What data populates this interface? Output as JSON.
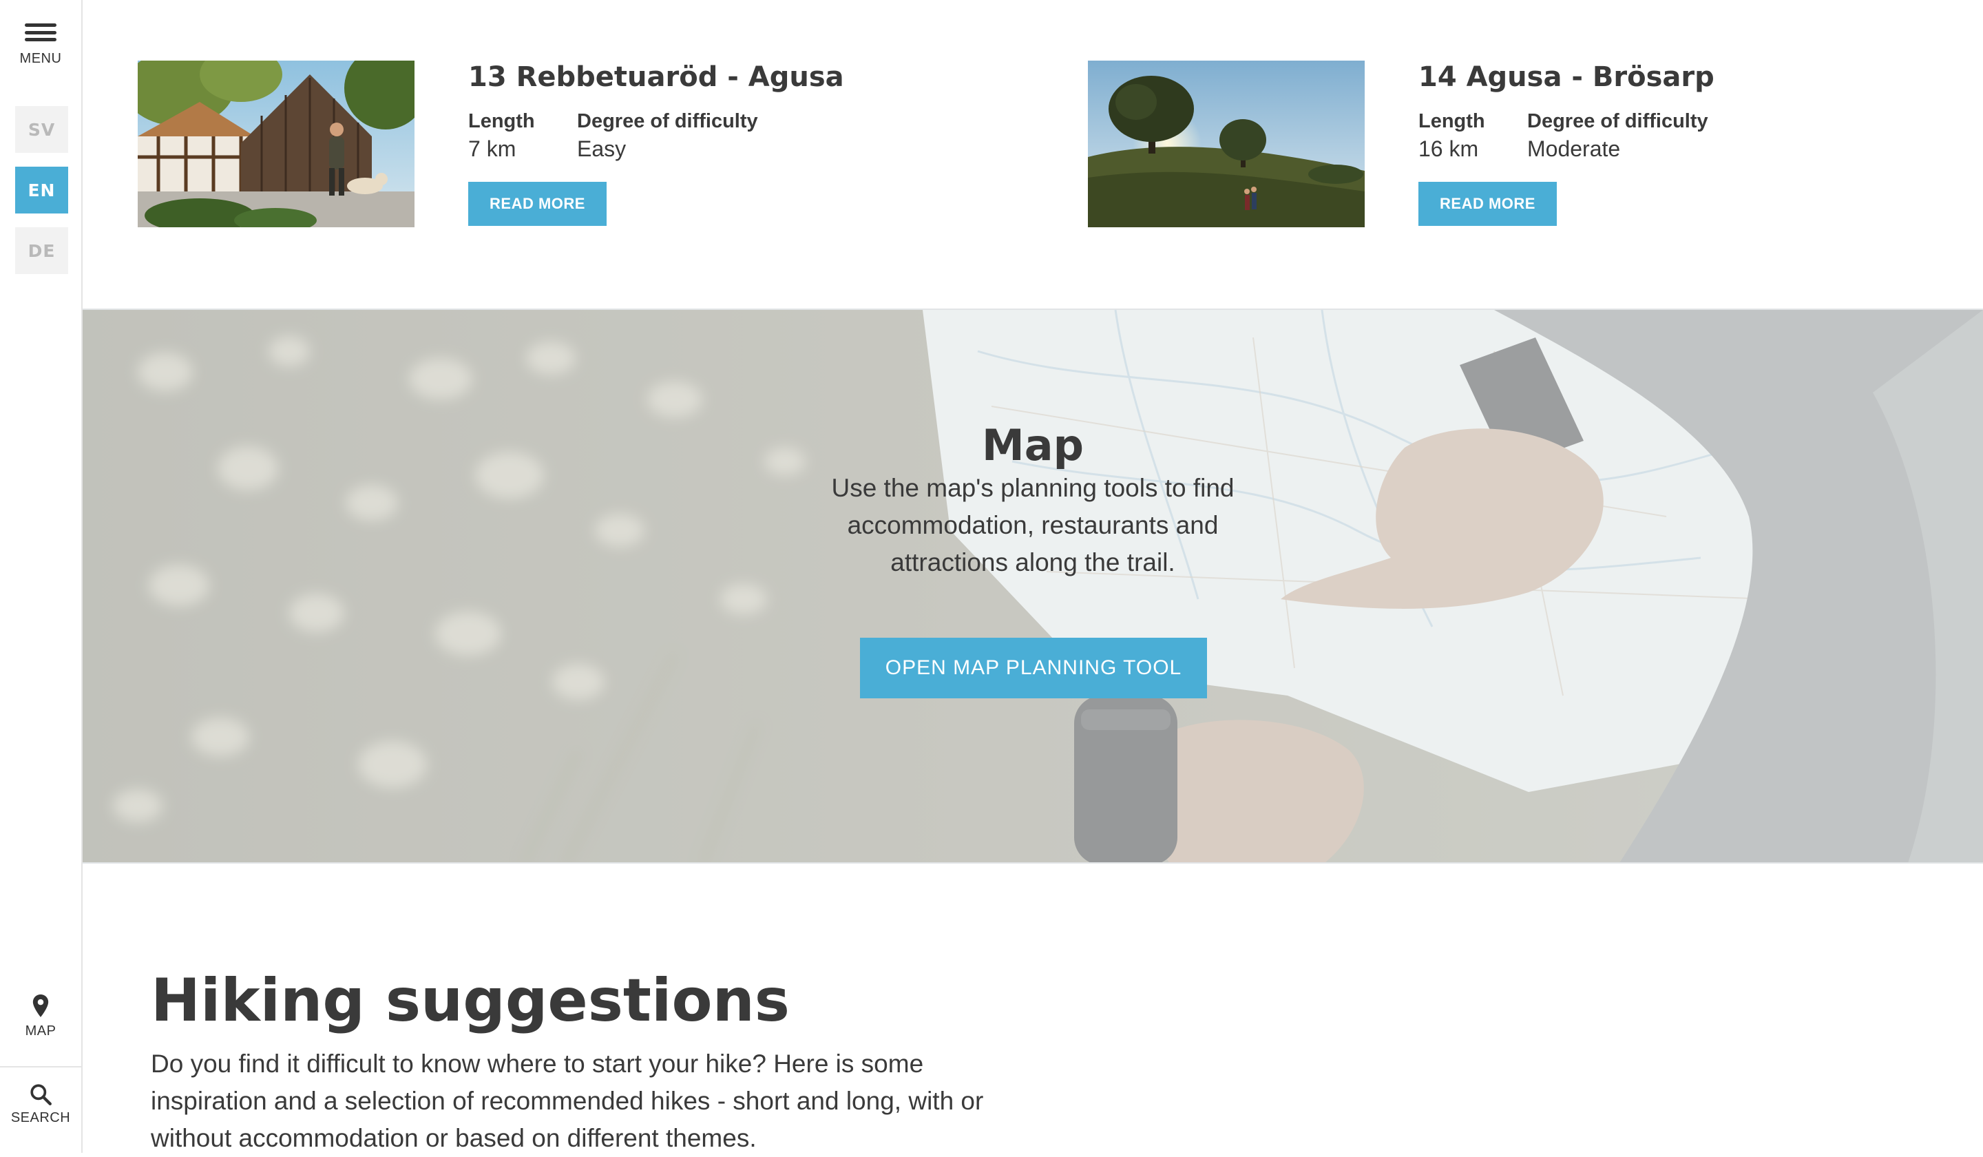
{
  "sidebar": {
    "menu_label": "MENU",
    "languages": [
      {
        "code": "SV",
        "active": false
      },
      {
        "code": "EN",
        "active": true
      },
      {
        "code": "DE",
        "active": false
      }
    ],
    "map_label": "MAP",
    "search_label": "SEARCH",
    "icons": {
      "menu": "hamburger-icon",
      "map": "map-pin-icon",
      "search": "search-icon"
    }
  },
  "routes": [
    {
      "title": "13 Rebbetuaröd - Agusa",
      "length_label": "Length",
      "length_value": "7 km",
      "difficulty_label": "Degree of difficulty",
      "difficulty_value": "Easy",
      "button_label": "READ MORE"
    },
    {
      "title": "14 Agusa - Brösarp",
      "length_label": "Length",
      "length_value": "16 km",
      "difficulty_label": "Degree of difficulty",
      "difficulty_value": "Moderate",
      "button_label": "READ MORE"
    }
  ],
  "map_section": {
    "title": "Map",
    "text": "Use the map's planning tools to find accommodation, restaurants and attractions along the trail.",
    "button_label": "OPEN MAP PLANNING TOOL"
  },
  "hiking": {
    "title": "Hiking suggestions",
    "text": "Do you find it difficult to know where to start your hike? Here is some inspiration and a selection of recommended hikes - short and long, with or without accommodation or based on different themes."
  },
  "colors": {
    "accent": "#4aaed6",
    "text": "#3a3a3a",
    "rail_border": "#e4e4e4",
    "lang_inactive_bg": "#f2f2f2",
    "lang_inactive_text": "#b9b9b9"
  }
}
